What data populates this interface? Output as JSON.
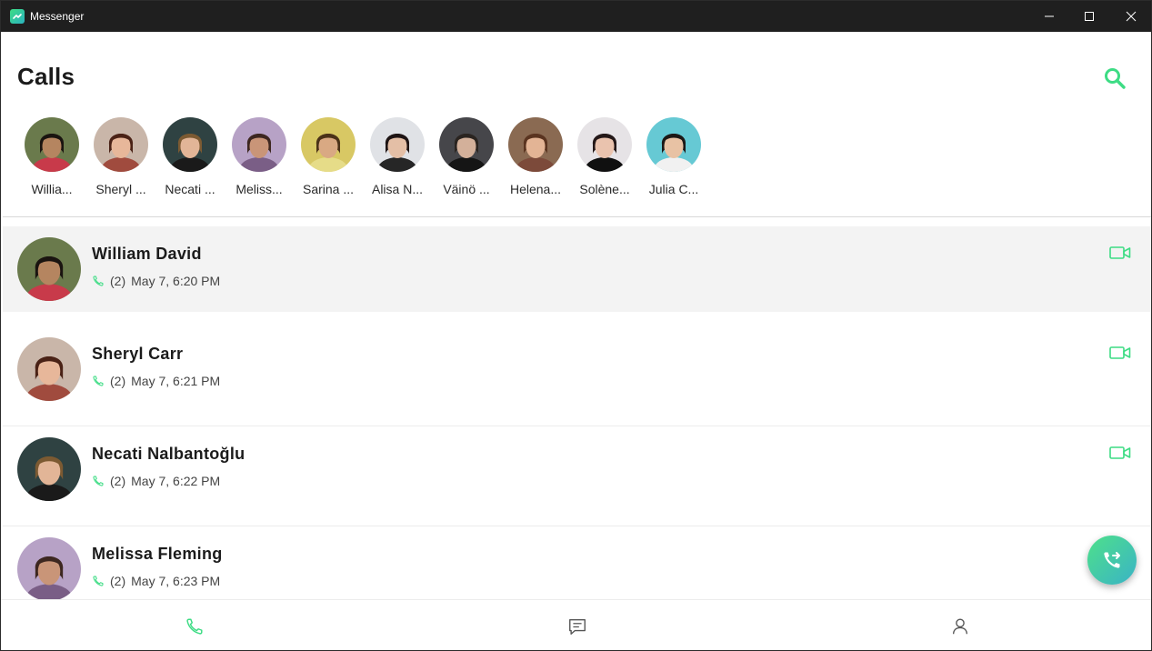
{
  "window": {
    "title": "Messenger"
  },
  "header": {
    "title": "Calls"
  },
  "favorites": [
    {
      "name": "Willia...",
      "bg": "#6a7a4c",
      "skin": "#b58560",
      "hair": "#1a1410",
      "shirt": "#c83a4a"
    },
    {
      "name": "Sheryl ...",
      "bg": "#c9b6a9",
      "skin": "#e7b79a",
      "hair": "#4a2216",
      "shirt": "#a04b3e"
    },
    {
      "name": "Necati ...",
      "bg": "#2f4242",
      "skin": "#e2b597",
      "hair": "#7c5a32",
      "shirt": "#1a1a1a"
    },
    {
      "name": "Meliss...",
      "bg": "#b7a2c6",
      "skin": "#c99578",
      "hair": "#3d2720",
      "shirt": "#7a5e86"
    },
    {
      "name": "Sarina ...",
      "bg": "#d8c864",
      "skin": "#d9a983",
      "hair": "#4b3218",
      "shirt": "#e6dc88"
    },
    {
      "name": "Alisa N...",
      "bg": "#e0e2e6",
      "skin": "#e4bfa6",
      "hair": "#1e1414",
      "shirt": "#262626"
    },
    {
      "name": "Väinö ...",
      "bg": "#46464a",
      "skin": "#d3b09a",
      "hair": "#2a2420",
      "shirt": "#151515"
    },
    {
      "name": "Helena...",
      "bg": "#8a6a52",
      "skin": "#e3b495",
      "hair": "#5a3420",
      "shirt": "#7c4a3a"
    },
    {
      "name": "Solène...",
      "bg": "#e6e3e6",
      "skin": "#eac3ae",
      "hair": "#241818",
      "shirt": "#101010"
    },
    {
      "name": "Julia C...",
      "bg": "#66c9d4",
      "skin": "#e8c2a4",
      "hair": "#1c1816",
      "shirt": "#f1f1f1"
    }
  ],
  "calls": [
    {
      "name": "William David",
      "count": "(2)",
      "time": "May 7, 6:20 PM",
      "selected": true,
      "bg": "#6a7a4c",
      "skin": "#b58560",
      "hair": "#1a1410",
      "shirt": "#c83a4a"
    },
    {
      "name": "Sheryl Carr",
      "count": "(2)",
      "time": "May 7, 6:21 PM",
      "selected": false,
      "bg": "#c9b6a9",
      "skin": "#e7b79a",
      "hair": "#4a2216",
      "shirt": "#a04b3e"
    },
    {
      "name": "Necati Nalbantoğlu",
      "count": "(2)",
      "time": "May 7, 6:22 PM",
      "selected": false,
      "bg": "#2f4242",
      "skin": "#e2b597",
      "hair": "#7c5a32",
      "shirt": "#1a1a1a"
    },
    {
      "name": "Melissa Fleming",
      "count": "(2)",
      "time": "May 7, 6:23 PM",
      "selected": false,
      "bg": "#b7a2c6",
      "skin": "#c99578",
      "hair": "#3d2720",
      "shirt": "#7a5e86"
    }
  ],
  "icons": {
    "search": "search-icon",
    "video": "video-camera-icon",
    "phone": "phone-icon",
    "fab": "phone-forward-icon",
    "nav_calls": "phone-icon",
    "nav_chats": "chat-icon",
    "nav_profile": "person-icon"
  },
  "colors": {
    "accent": "#3ddc84",
    "accent_alt": "#3ab3c6",
    "selected_row": "#f3f3f3"
  }
}
